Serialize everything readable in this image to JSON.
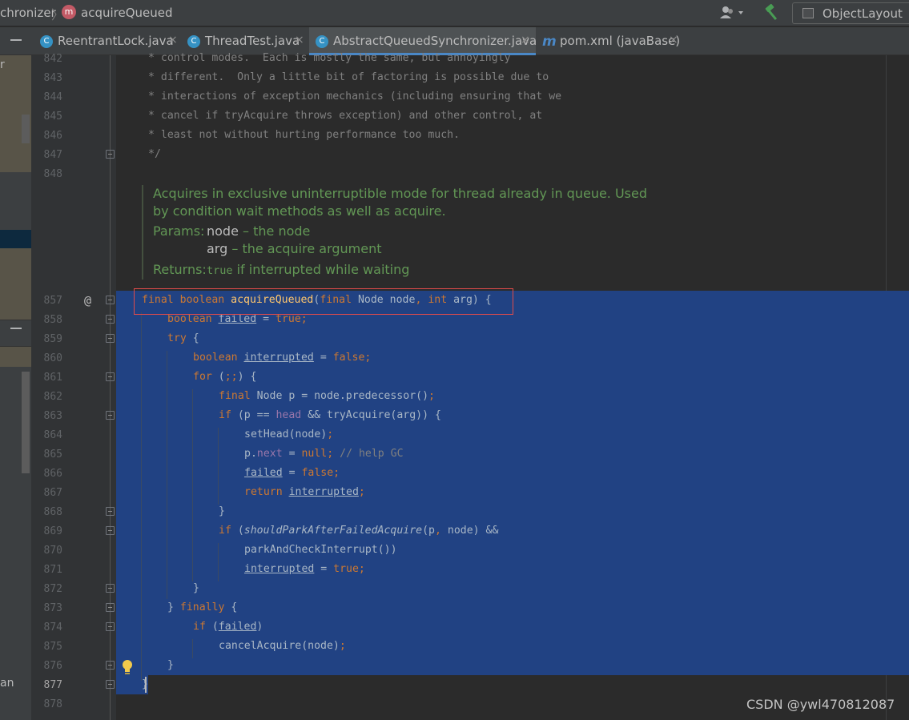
{
  "nav": {
    "class_crumb": "chronizer",
    "method_badge": "m",
    "method_crumb": "acquireQueued",
    "run_config": "ObjectLayout"
  },
  "tabs": [
    {
      "label": "ReentrantLock.java",
      "icon": "c-class-icon"
    },
    {
      "label": "ThreadTest.java",
      "icon": "c-class-icon"
    },
    {
      "label": "AbstractQueuedSynchronizer.java",
      "icon": "c-class-icon",
      "active": true
    },
    {
      "label": "pom.xml (javaBase)",
      "icon": "maven-m-icon"
    }
  ],
  "tab_close": "×",
  "left_panel": {
    "text_top": "r",
    "text_bottom": "an"
  },
  "line_numbers": [
    "842",
    "843",
    "844",
    "845",
    "846",
    "847",
    "848",
    "857",
    "858",
    "859",
    "860",
    "861",
    "862",
    "863",
    "864",
    "865",
    "866",
    "867",
    "868",
    "869",
    "870",
    "871",
    "872",
    "873",
    "874",
    "875",
    "876",
    "877",
    "878"
  ],
  "gutter_at": "@",
  "comment_lines": [
    "* control modes.  Each is mostly the same, but annoyingly",
    "* different.  Only a little bit of factoring is possible due to",
    "* interactions of exception mechanics (including ensuring that we",
    "* cancel if tryAcquire throws exception) and other control, at",
    "* least not without hurting performance too much.",
    "*/"
  ],
  "doc": {
    "description": "Acquires in exclusive uninterruptible mode for thread already in queue. Used by condition wait methods as well as acquire.",
    "params_label": "Params:",
    "param1_name": "node",
    "param1_desc": " – the node",
    "param2_name": "arg",
    "param2_desc": " – the acquire argument",
    "returns_label": "Returns:",
    "returns_code": "true",
    "returns_desc": " if interrupted while waiting"
  },
  "code": {
    "l857": {
      "a": "final boolean ",
      "b": "acquireQueued",
      "c": "(",
      "d": "final ",
      "e": "Node node",
      "f": ", ",
      "g": "int ",
      "h": "arg) {"
    },
    "l858": {
      "a": "boolean ",
      "b": "failed",
      "c": " = ",
      "d": "true;"
    },
    "l859": {
      "a": "try",
      "b": " {"
    },
    "l860": {
      "a": "boolean ",
      "b": "interrupted",
      "c": " = ",
      "d": "false;"
    },
    "l861": {
      "a": "for ",
      "b": "(",
      "c": ";;",
      "d": ") {"
    },
    "l862": {
      "a": "final ",
      "b": "Node p = node.predecessor()",
      "c": ";"
    },
    "l863": {
      "a": "if ",
      "b": "(p == ",
      "c": "head ",
      "d": "&& tryAcquire(arg)) {"
    },
    "l864": {
      "a": "setHead(node)",
      "b": ";"
    },
    "l865": {
      "a": "p.",
      "b": "next",
      "c": " = ",
      "d": "null; ",
      "e": "// help GC"
    },
    "l866": {
      "a": "failed",
      "b": " = ",
      "c": "false;"
    },
    "l867": {
      "a": "return ",
      "b": "interrupted",
      "c": ";"
    },
    "l868": {
      "a": "}"
    },
    "l869": {
      "a": "if ",
      "b": "(",
      "c": "shouldParkAfterFailedAcquire",
      "d": "(p",
      "e": ", ",
      "f": "node) &&"
    },
    "l870": {
      "a": "parkAndCheckInterrupt())"
    },
    "l871": {
      "a": "interrupted",
      "b": " = ",
      "c": "true;"
    },
    "l872": {
      "a": "}"
    },
    "l873": {
      "a": "} ",
      "b": "finally ",
      "c": "{"
    },
    "l874": {
      "a": "if ",
      "b": "(",
      "c": "failed",
      "d": ")"
    },
    "l875": {
      "a": "cancelAcquire(node)",
      "b": ";"
    },
    "l876": {
      "a": "}"
    },
    "l877": {
      "a": "}"
    }
  },
  "watermark": "CSDN @ywl470812087",
  "colors": {
    "background": "#2b2b2b",
    "selection": "#214283",
    "keyword": "#cc7832",
    "method": "#ffc66d",
    "doc_comment": "#629755",
    "highlight_box": "#e04b4b"
  }
}
